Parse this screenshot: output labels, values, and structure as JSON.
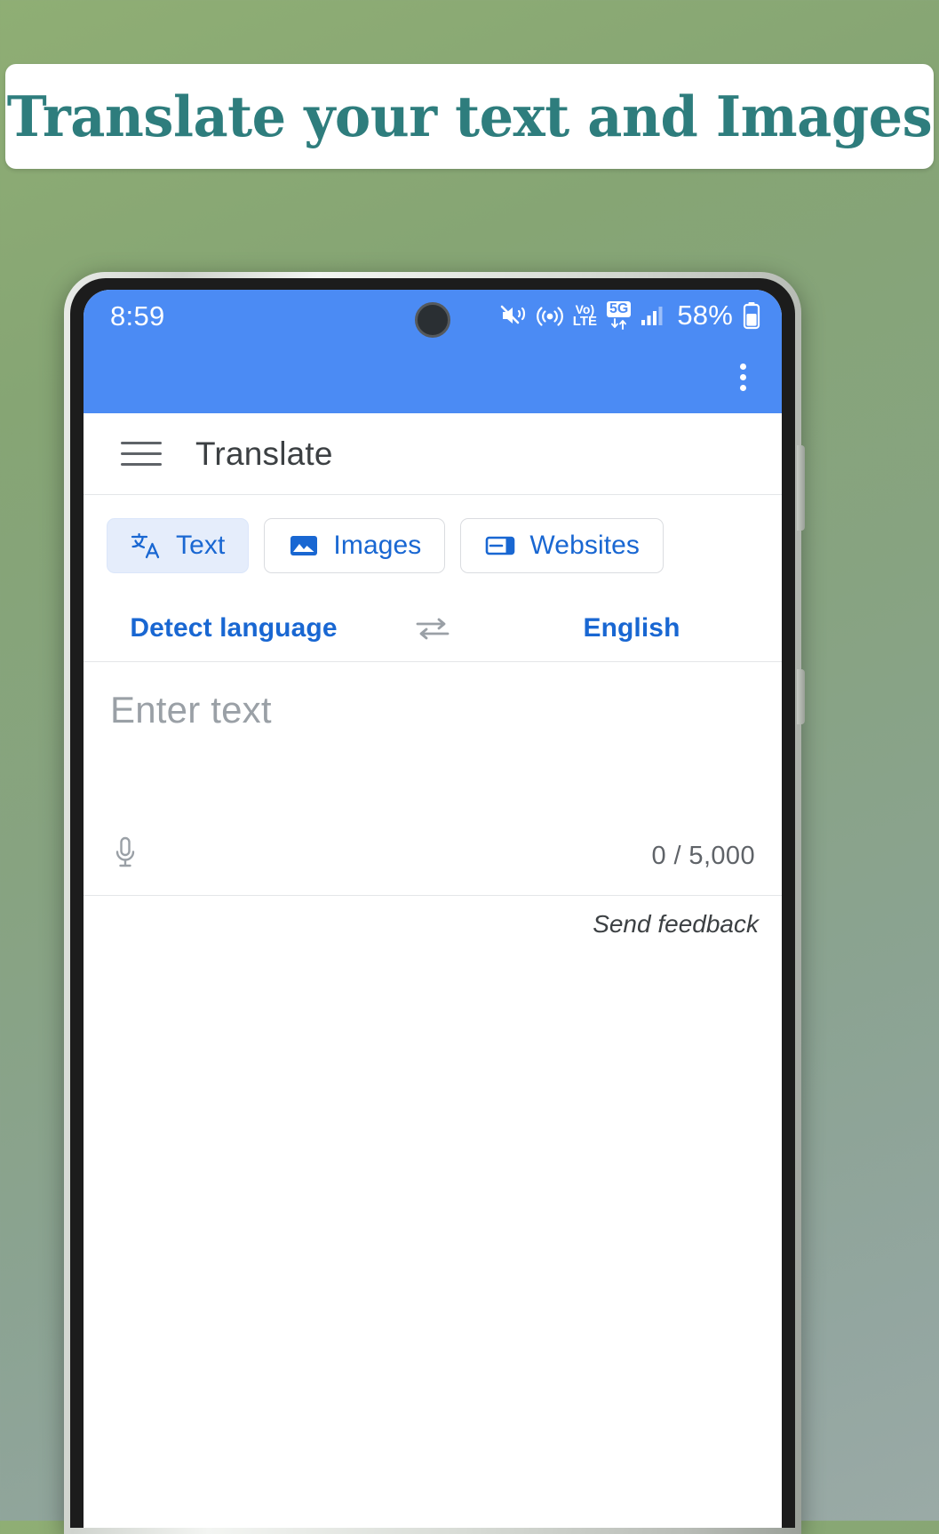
{
  "banner": {
    "text": "Translate your text and Images",
    "text_color": "#2e7d7d",
    "background": "#ffffff"
  },
  "background": {
    "gradient_from": "#8fae74",
    "gradient_to": "#9aaaa6"
  },
  "phone": {
    "status_bar": {
      "time": "8:59",
      "background": "#4b8bf4",
      "icons": [
        "mute-vibrate-icon",
        "hotspot-icon",
        "volte-icon",
        "5g-data-icon",
        "signal-bars-icon",
        "battery-icon"
      ],
      "volte_top": "Vo)",
      "volte_bottom": "LTE",
      "network_badge": "5G",
      "battery_percent": "58%"
    },
    "app_bar": {
      "background": "#4b8bf4",
      "overflow_menu": "more-options-icon"
    },
    "header": {
      "menu_icon": "hamburger-menu-icon",
      "title": "Translate"
    },
    "tabs": [
      {
        "label": "Text",
        "icon": "translate-icon",
        "active": true
      },
      {
        "label": "Images",
        "icon": "image-icon",
        "active": false
      },
      {
        "label": "Websites",
        "icon": "website-icon",
        "active": false
      }
    ],
    "language_row": {
      "source": "Detect language",
      "swap_icon": "swap-languages-icon",
      "target": "English"
    },
    "input": {
      "placeholder": "Enter text",
      "mic_icon": "microphone-icon",
      "counter": "0 / 5,000",
      "value": ""
    },
    "feedback": {
      "label": "Send feedback"
    },
    "accent_color": "#1967d2"
  }
}
